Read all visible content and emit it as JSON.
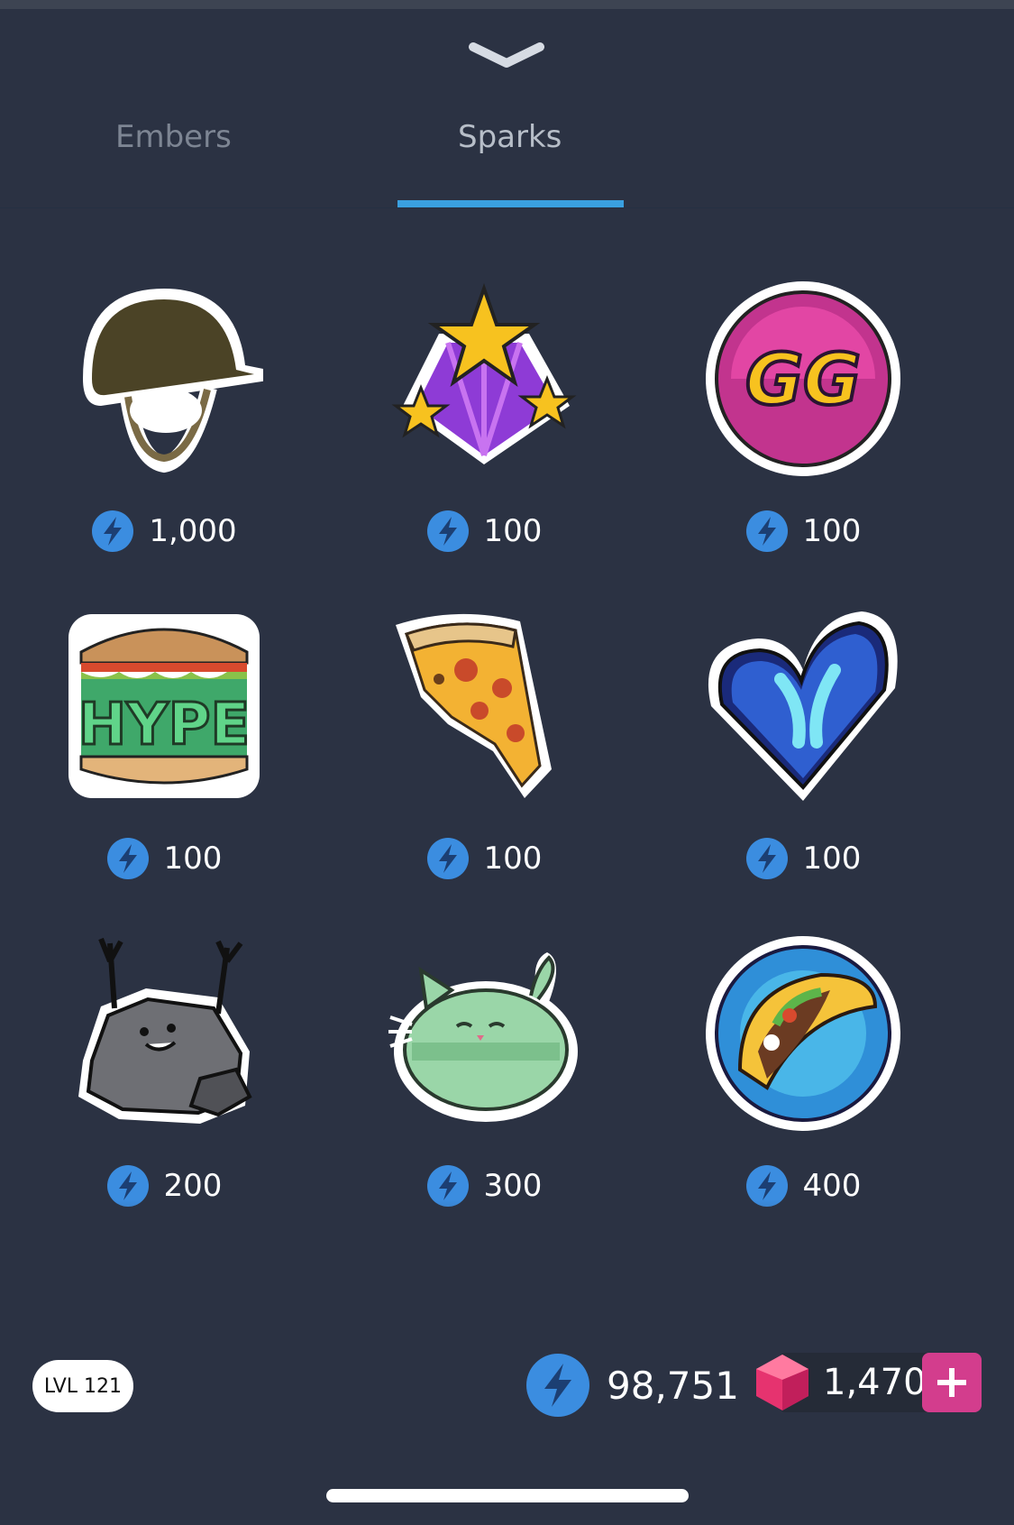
{
  "tabs": [
    {
      "label": "Embers",
      "selected": false
    },
    {
      "label": "Sparks",
      "selected": true
    }
  ],
  "items": [
    {
      "name": "helmet",
      "price": "1,000"
    },
    {
      "name": "stars-burst",
      "price": "100"
    },
    {
      "name": "gg-badge",
      "price": "100"
    },
    {
      "name": "hype-sandwich",
      "price": "100"
    },
    {
      "name": "pizza-slice",
      "price": "100"
    },
    {
      "name": "xbox-heart",
      "price": "100"
    },
    {
      "name": "rock-cheer",
      "price": "200"
    },
    {
      "name": "macaron-cat",
      "price": "300"
    },
    {
      "name": "taco-badge",
      "price": "400"
    }
  ],
  "footer": {
    "level": "LVL 121",
    "sparks_balance": "98,751",
    "gems_balance": "1,470",
    "plus_icon": "plus-icon"
  },
  "colors": {
    "background": "#2b3243",
    "accent": "#3aa0e0",
    "plus_button": "#d33d8d",
    "spark_icon": "#3b8de0"
  }
}
